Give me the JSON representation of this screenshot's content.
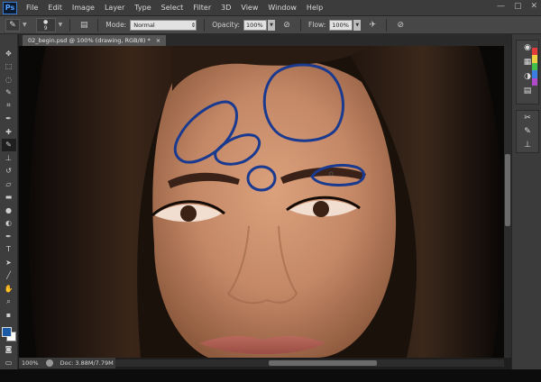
{
  "app": {
    "logo": "Ps",
    "menu": [
      "File",
      "Edit",
      "Image",
      "Layer",
      "Type",
      "Select",
      "Filter",
      "3D",
      "View",
      "Window",
      "Help"
    ],
    "window_controls": [
      "—",
      "▢",
      "✕"
    ]
  },
  "options_bar": {
    "brush_size": "9",
    "mode_label": "Mode:",
    "mode_value": "Normal",
    "opacity_label": "Opacity:",
    "opacity_value": "100%",
    "flow_label": "Flow:",
    "flow_value": "100%"
  },
  "document": {
    "tab_title": "02_begin.psd @ 100% (drawing, RGB/8) *",
    "close_glyph": "×"
  },
  "status": {
    "zoom": "100%",
    "doc_info": "Doc: 3.88M/7.79M"
  },
  "tools": [
    "move-tool",
    "marquee-tool",
    "lasso-tool",
    "quick-select-tool",
    "crop-tool",
    "eyedropper-tool",
    "healing-tool",
    "brush-tool",
    "clone-stamp-tool",
    "history-brush-tool",
    "eraser-tool",
    "gradient-tool",
    "blur-tool",
    "dodge-tool",
    "pen-tool",
    "type-tool",
    "path-select-tool",
    "line-tool",
    "hand-tool",
    "zoom-tool"
  ],
  "colors": {
    "foreground": "#1b5aa5",
    "background": "#ffffff",
    "stroke": "#1a3a8f"
  }
}
